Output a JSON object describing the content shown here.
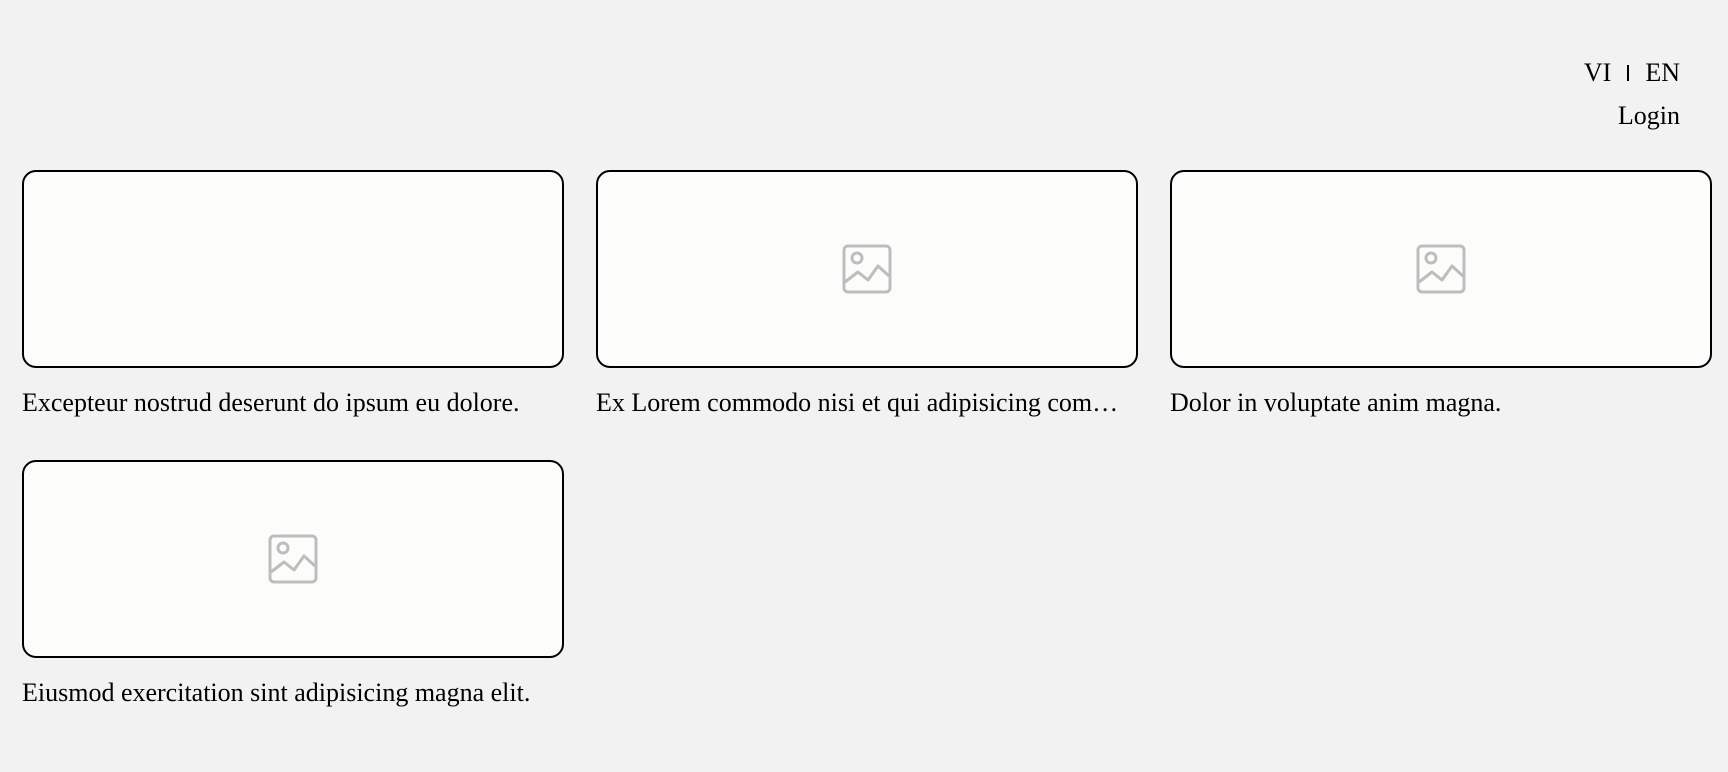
{
  "header": {
    "lang_vi": "VI",
    "lang_en": "EN",
    "login": "Login"
  },
  "cards": [
    {
      "title": "Excepteur nostrud deserunt do ipsum eu dolore.",
      "thumbnail_icon": "none"
    },
    {
      "title": "Ex Lorem commodo nisi et qui adipisicing commodo.",
      "thumbnail_icon": "image-placeholder-icon"
    },
    {
      "title": "Dolor in voluptate anim magna.",
      "thumbnail_icon": "image-placeholder-icon"
    },
    {
      "title": "Eiusmod exercitation sint adipisicing magna elit.",
      "thumbnail_icon": "image-placeholder-icon"
    }
  ],
  "colors": {
    "background": "#f2f2f2",
    "card_fill": "#fcfdfb",
    "card_border": "#000000",
    "icon": "#bdbdbd"
  }
}
